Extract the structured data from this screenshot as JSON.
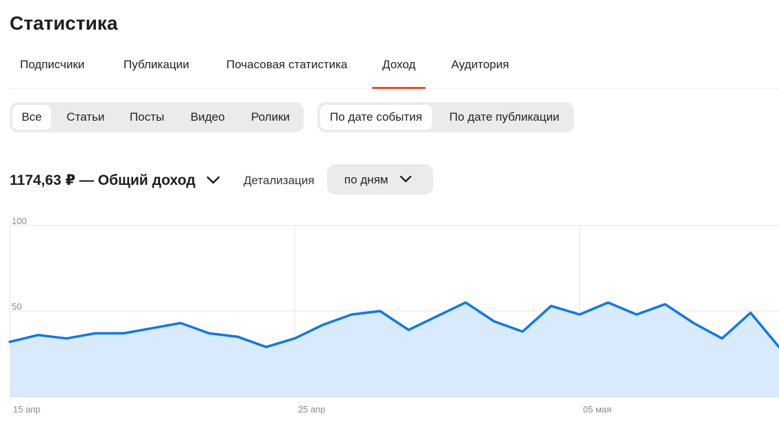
{
  "page": {
    "title": "Статистика"
  },
  "tabs": [
    {
      "label": "Подписчики"
    },
    {
      "label": "Публикации"
    },
    {
      "label": "Почасовая статистика"
    },
    {
      "label": "Доход",
      "active": true
    },
    {
      "label": "Аудитория"
    }
  ],
  "content_filter": {
    "options": [
      "Все",
      "Статьи",
      "Посты",
      "Видео",
      "Ролики"
    ],
    "selected": "Все"
  },
  "date_filter": {
    "options": [
      "По дате события",
      "По дате публикации"
    ],
    "selected": "По дате события"
  },
  "summary": {
    "total_text": "1174,63 ₽ — Общий доход"
  },
  "detail": {
    "label": "Детализация",
    "value": "по дням"
  },
  "icons": {
    "summary_toggle": "chevron-down-icon",
    "detail_toggle": "chevron-down-icon"
  },
  "colors": {
    "accent": "#f04e23",
    "line": "#0a77f0",
    "area": "#d6e9fc"
  },
  "chart_data": {
    "type": "area",
    "ylim": [
      0,
      100
    ],
    "y_ticks": [
      "0",
      "50",
      "100"
    ],
    "x_tick_labels": [
      {
        "day_index": 0,
        "label": "15 апр"
      },
      {
        "day_index": 10,
        "label": "25 апр"
      },
      {
        "day_index": 20,
        "label": "05 мая"
      }
    ],
    "values": [
      32,
      36,
      34,
      37,
      37,
      40,
      43,
      37,
      35,
      29,
      34,
      42,
      48,
      50,
      39,
      47,
      55,
      44,
      38,
      53,
      48,
      55,
      48,
      54,
      43,
      34,
      49,
      29
    ],
    "grid": true
  }
}
